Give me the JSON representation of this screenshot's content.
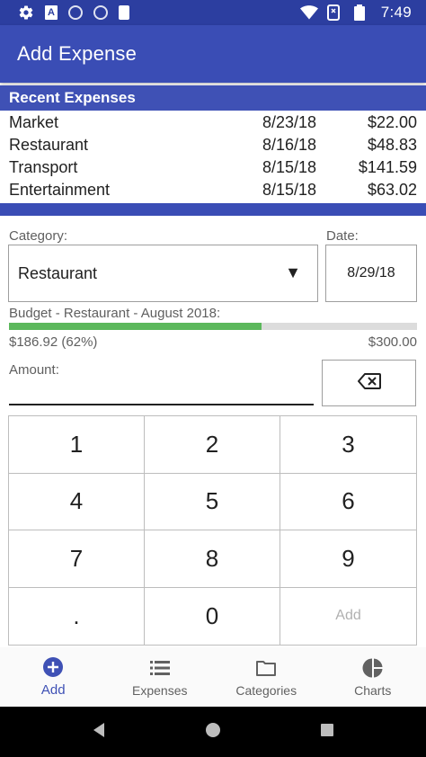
{
  "status_bar": {
    "time": "7:49",
    "icons": [
      "gear-icon",
      "a-icon",
      "circle-icon",
      "circle-icon",
      "sd-card-icon",
      "wifi-icon",
      "no-sim-icon",
      "battery-icon"
    ]
  },
  "app_bar": {
    "title": "Add Expense"
  },
  "recent": {
    "header": "Recent Expenses",
    "items": [
      {
        "name": "Market",
        "date": "8/23/18",
        "amount": "$22.00"
      },
      {
        "name": "Restaurant",
        "date": "8/16/18",
        "amount": "$48.83"
      },
      {
        "name": "Transport",
        "date": "8/15/18",
        "amount": "$141.59"
      },
      {
        "name": "Entertainment",
        "date": "8/15/18",
        "amount": "$63.02"
      }
    ]
  },
  "form": {
    "category_label": "Category:",
    "category_value": "Restaurant",
    "date_label": "Date:",
    "date_value": "8/29/18",
    "budget_label": "Budget - Restaurant - August 2018:",
    "budget_spent": "$186.92 (62%)",
    "budget_total": "$300.00",
    "budget_fraction": 0.62,
    "amount_label": "Amount:",
    "amount_value": ""
  },
  "keypad": {
    "keys": [
      "1",
      "2",
      "3",
      "4",
      "5",
      "6",
      "7",
      "8",
      "9",
      ".",
      "0",
      "Add"
    ]
  },
  "bottom_nav": {
    "items": [
      {
        "label": "Add",
        "icon": "add-circle-icon",
        "active": true
      },
      {
        "label": "Expenses",
        "icon": "list-icon",
        "active": false
      },
      {
        "label": "Categories",
        "icon": "folder-icon",
        "active": false
      },
      {
        "label": "Charts",
        "icon": "pie-chart-icon",
        "active": false
      }
    ]
  },
  "colors": {
    "primary": "#3f51b5",
    "primary_dark": "#2c3ea0",
    "budget_fill": "#5cb85c",
    "budget_track": "#dcdcdc"
  }
}
